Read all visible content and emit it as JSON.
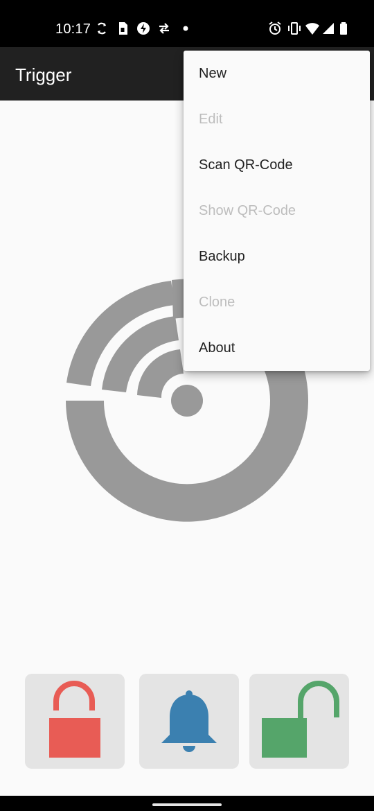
{
  "status_bar": {
    "time": "10:17",
    "left_icons": [
      "sync-icon",
      "sim-card-icon",
      "flash-icon",
      "data-transfer-icon",
      "dot-icon"
    ],
    "right_icons": [
      "alarm-icon",
      "vibrate-icon",
      "wifi-icon",
      "signal-icon",
      "battery-icon"
    ]
  },
  "app_bar": {
    "title": "Trigger"
  },
  "main": {
    "graphic_icon": "trigger-logo-icon",
    "graphic_color": "#999999"
  },
  "menu": {
    "items": [
      {
        "label": "New",
        "enabled": true
      },
      {
        "label": "Edit",
        "enabled": false
      },
      {
        "label": "Scan QR-Code",
        "enabled": true
      },
      {
        "label": "Show QR-Code",
        "enabled": false
      },
      {
        "label": "Backup",
        "enabled": true
      },
      {
        "label": "Clone",
        "enabled": false
      },
      {
        "label": "About",
        "enabled": true
      }
    ]
  },
  "actions": {
    "lock": {
      "icon": "lock-icon",
      "color": "#e85c55"
    },
    "ring": {
      "icon": "bell-icon",
      "color": "#3b80b0"
    },
    "unlock": {
      "icon": "unlock-icon",
      "color": "#55a56a"
    }
  },
  "colors": {
    "status_bar": "#000000",
    "app_bar": "#212121",
    "background": "#fafafa",
    "button_background": "#e4e4e4",
    "menu_text": "#212121",
    "menu_text_disabled": "#bdbdbd"
  }
}
